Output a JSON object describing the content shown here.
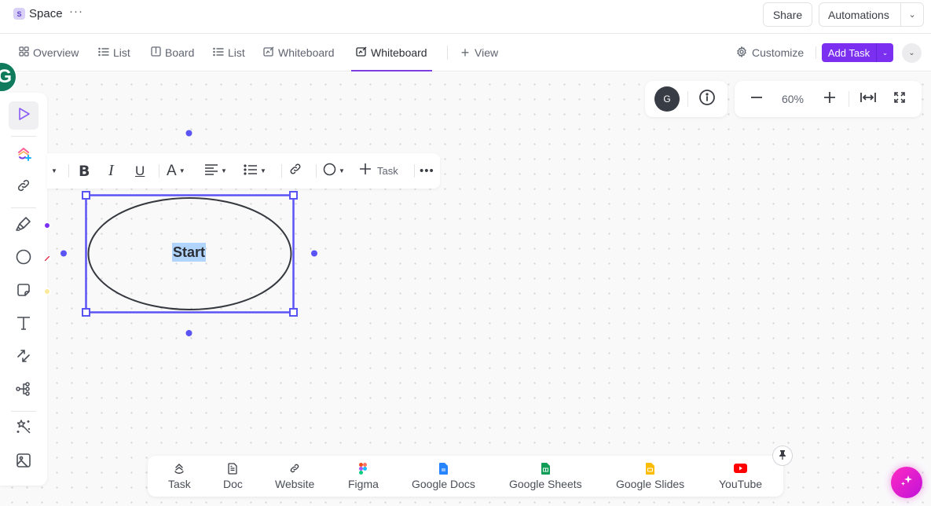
{
  "header": {
    "space_badge": "S",
    "space_name": "Space",
    "more": "···",
    "share_label": "Share",
    "automations_label": "Automations"
  },
  "tabs": [
    {
      "label": "Overview",
      "icon": "overview-icon",
      "active": false
    },
    {
      "label": "List",
      "icon": "list-icon",
      "active": false
    },
    {
      "label": "Board",
      "icon": "board-icon",
      "active": false
    },
    {
      "label": "List",
      "icon": "list-icon",
      "active": false
    },
    {
      "label": "Whiteboard",
      "icon": "whiteboard-icon",
      "active": false
    },
    {
      "label": "Whiteboard",
      "icon": "whiteboard-icon",
      "active": true
    }
  ],
  "view_label": "View",
  "customize_label": "Customize",
  "add_task_label": "Add Task",
  "canvas": {
    "presence_avatar": "G",
    "user_avatar": "G",
    "zoom_level": "60%",
    "shape_text": "Start",
    "format_toolbar": {
      "task_label": "Task"
    }
  },
  "left_tools": [
    {
      "name": "select-tool",
      "icon": "cursor-icon",
      "active": true
    },
    {
      "name": "clickup-ai-tool",
      "icon": "clickup-plus-icon"
    },
    {
      "name": "link-tool",
      "icon": "link-icon"
    },
    {
      "name": "pen-tool",
      "icon": "marker-icon"
    },
    {
      "name": "shape-tool",
      "icon": "circle-icon"
    },
    {
      "name": "sticky-note-tool",
      "icon": "sticky-note-icon"
    },
    {
      "name": "text-tool",
      "icon": "text-icon"
    },
    {
      "name": "connector-tool",
      "icon": "connector-icon"
    },
    {
      "name": "mindmap-tool",
      "icon": "mindmap-icon"
    },
    {
      "name": "ai-magic-tool",
      "icon": "magic-wand-icon"
    },
    {
      "name": "image-tool",
      "icon": "image-icon"
    }
  ],
  "tool_swatches": {
    "pen": "#7b2ff0",
    "shape": "#e0203a",
    "sticky": "#fde99a"
  },
  "bottom_bar": [
    {
      "label": "Task",
      "icon": "task-icon"
    },
    {
      "label": "Doc",
      "icon": "doc-icon"
    },
    {
      "label": "Website",
      "icon": "link-icon"
    },
    {
      "label": "Figma",
      "icon": "figma-icon"
    },
    {
      "label": "Google Docs",
      "icon": "google-docs-icon"
    },
    {
      "label": "Google Sheets",
      "icon": "google-sheets-icon"
    },
    {
      "label": "Google Slides",
      "icon": "google-slides-icon"
    },
    {
      "label": "YouTube",
      "icon": "youtube-icon"
    }
  ],
  "colors": {
    "accent": "#7b2ff0",
    "selection": "#5b54f5",
    "text_highlight": "#b1d4fc"
  }
}
